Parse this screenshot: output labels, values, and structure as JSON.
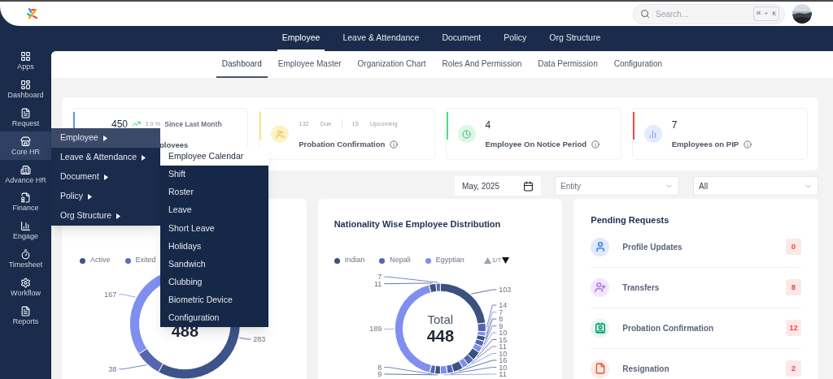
{
  "header": {
    "search": {
      "placeholder": "Search...",
      "shortcut": "⌘ + K"
    }
  },
  "sidebar": {
    "items": [
      {
        "label": "Apps",
        "selected": false
      },
      {
        "label": "Dashboard",
        "selected": false
      },
      {
        "label": "Request",
        "selected": false
      },
      {
        "label": "Core HR",
        "selected": true
      },
      {
        "label": "Advance HR",
        "selected": false
      },
      {
        "label": "Finance",
        "selected": false
      },
      {
        "label": "Engage",
        "selected": false
      },
      {
        "label": "Timesheet",
        "selected": false
      },
      {
        "label": "Workflow",
        "selected": false
      },
      {
        "label": "Reports",
        "selected": false
      }
    ]
  },
  "top_tabs": [
    {
      "label": "Employee",
      "selected": true
    },
    {
      "label": "Leave & Attendance",
      "selected": false
    },
    {
      "label": "Document",
      "selected": false
    },
    {
      "label": "Policy",
      "selected": false
    },
    {
      "label": "Org Structure",
      "selected": false
    }
  ],
  "sub_tabs": [
    {
      "label": "Dashboard",
      "selected": true
    },
    {
      "label": "Employee Master",
      "selected": false
    },
    {
      "label": "Organization Chart",
      "selected": false
    },
    {
      "label": "Roles And Permission",
      "selected": false
    },
    {
      "label": "Data Permission",
      "selected": false
    },
    {
      "label": "Configuration",
      "selected": false
    }
  ],
  "stats": [
    {
      "kind": "growth",
      "value": "450",
      "change": "3.9 %",
      "since": "Since Last Month",
      "label": "ployees",
      "color": "#6d8ef0"
    },
    {
      "kind": "split",
      "figures": [
        {
          "value": "132",
          "label": "Due"
        },
        {
          "value": "15",
          "label": "Upcoming"
        }
      ],
      "label": "Probation Confirmation",
      "color": "#fde68a"
    },
    {
      "kind": "single",
      "value": "4",
      "label": "Employee On Notice Period",
      "color": "#4ade80"
    },
    {
      "kind": "single",
      "value": "7",
      "label": "Employees on PIP",
      "color": "#e05252"
    }
  ],
  "filters": {
    "month": "May, 2025",
    "entity": {
      "placeholder": "Entity"
    },
    "scope": {
      "value": "All"
    }
  },
  "status_chart": {
    "legend": [
      {
        "name": "Active",
        "color": "#3d5488"
      },
      {
        "name": "Exited",
        "color": "#5b6cc0"
      }
    ],
    "center_value": "488",
    "chart_data": {
      "type": "donut",
      "values": [
        283,
        38,
        167,
        0
      ],
      "data_labels": true
    }
  },
  "nationality_chart": {
    "title": "Nationality Wise Employee Distribution",
    "legend": [
      {
        "name": "Indian",
        "color": "#3b5280"
      },
      {
        "name": "Nepali",
        "color": "#5665b0"
      },
      {
        "name": "Egyptian",
        "color": "#7f8ff0"
      }
    ],
    "pager": {
      "text": "1/7",
      "prev_disabled": true,
      "next_disabled": false
    },
    "center_label": "Total",
    "center_value": "448",
    "chart_data": {
      "type": "donut",
      "values": [
        103,
        14,
        7,
        8,
        9,
        10,
        15,
        11,
        10,
        16,
        10,
        11,
        9,
        8,
        189,
        11,
        7
      ],
      "data_labels": true
    }
  },
  "pending": {
    "title": "Pending Requests",
    "items": [
      {
        "label": "Profile Updates",
        "count": "0",
        "color": "#3b82f6"
      },
      {
        "label": "Transfers",
        "count": "8",
        "color": "#b57be8"
      },
      {
        "label": "Probation Confirmation",
        "count": "12",
        "color": "#10a36b"
      },
      {
        "label": "Resignation",
        "count": "2",
        "color": "#e2684c"
      }
    ]
  },
  "core_hr_menu": {
    "items": [
      {
        "label": "Employee",
        "selected": true
      },
      {
        "label": "Leave & Attendance",
        "selected": false
      },
      {
        "label": "Document",
        "selected": false
      },
      {
        "label": "Policy",
        "selected": false
      },
      {
        "label": "Org Structure",
        "selected": false
      }
    ]
  },
  "leave_submenu": {
    "items": [
      {
        "label": "Employee Calendar",
        "selected": true
      },
      {
        "label": "Shift",
        "selected": false
      },
      {
        "label": "Roster",
        "selected": false
      },
      {
        "label": "Leave",
        "selected": false
      },
      {
        "label": "Short Leave",
        "selected": false
      },
      {
        "label": "Holidays",
        "selected": false
      },
      {
        "label": "Sandwich",
        "selected": false
      },
      {
        "label": "Clubbing",
        "selected": false
      },
      {
        "label": "Biometric Device",
        "selected": false
      },
      {
        "label": "Configuration",
        "selected": false
      }
    ]
  }
}
